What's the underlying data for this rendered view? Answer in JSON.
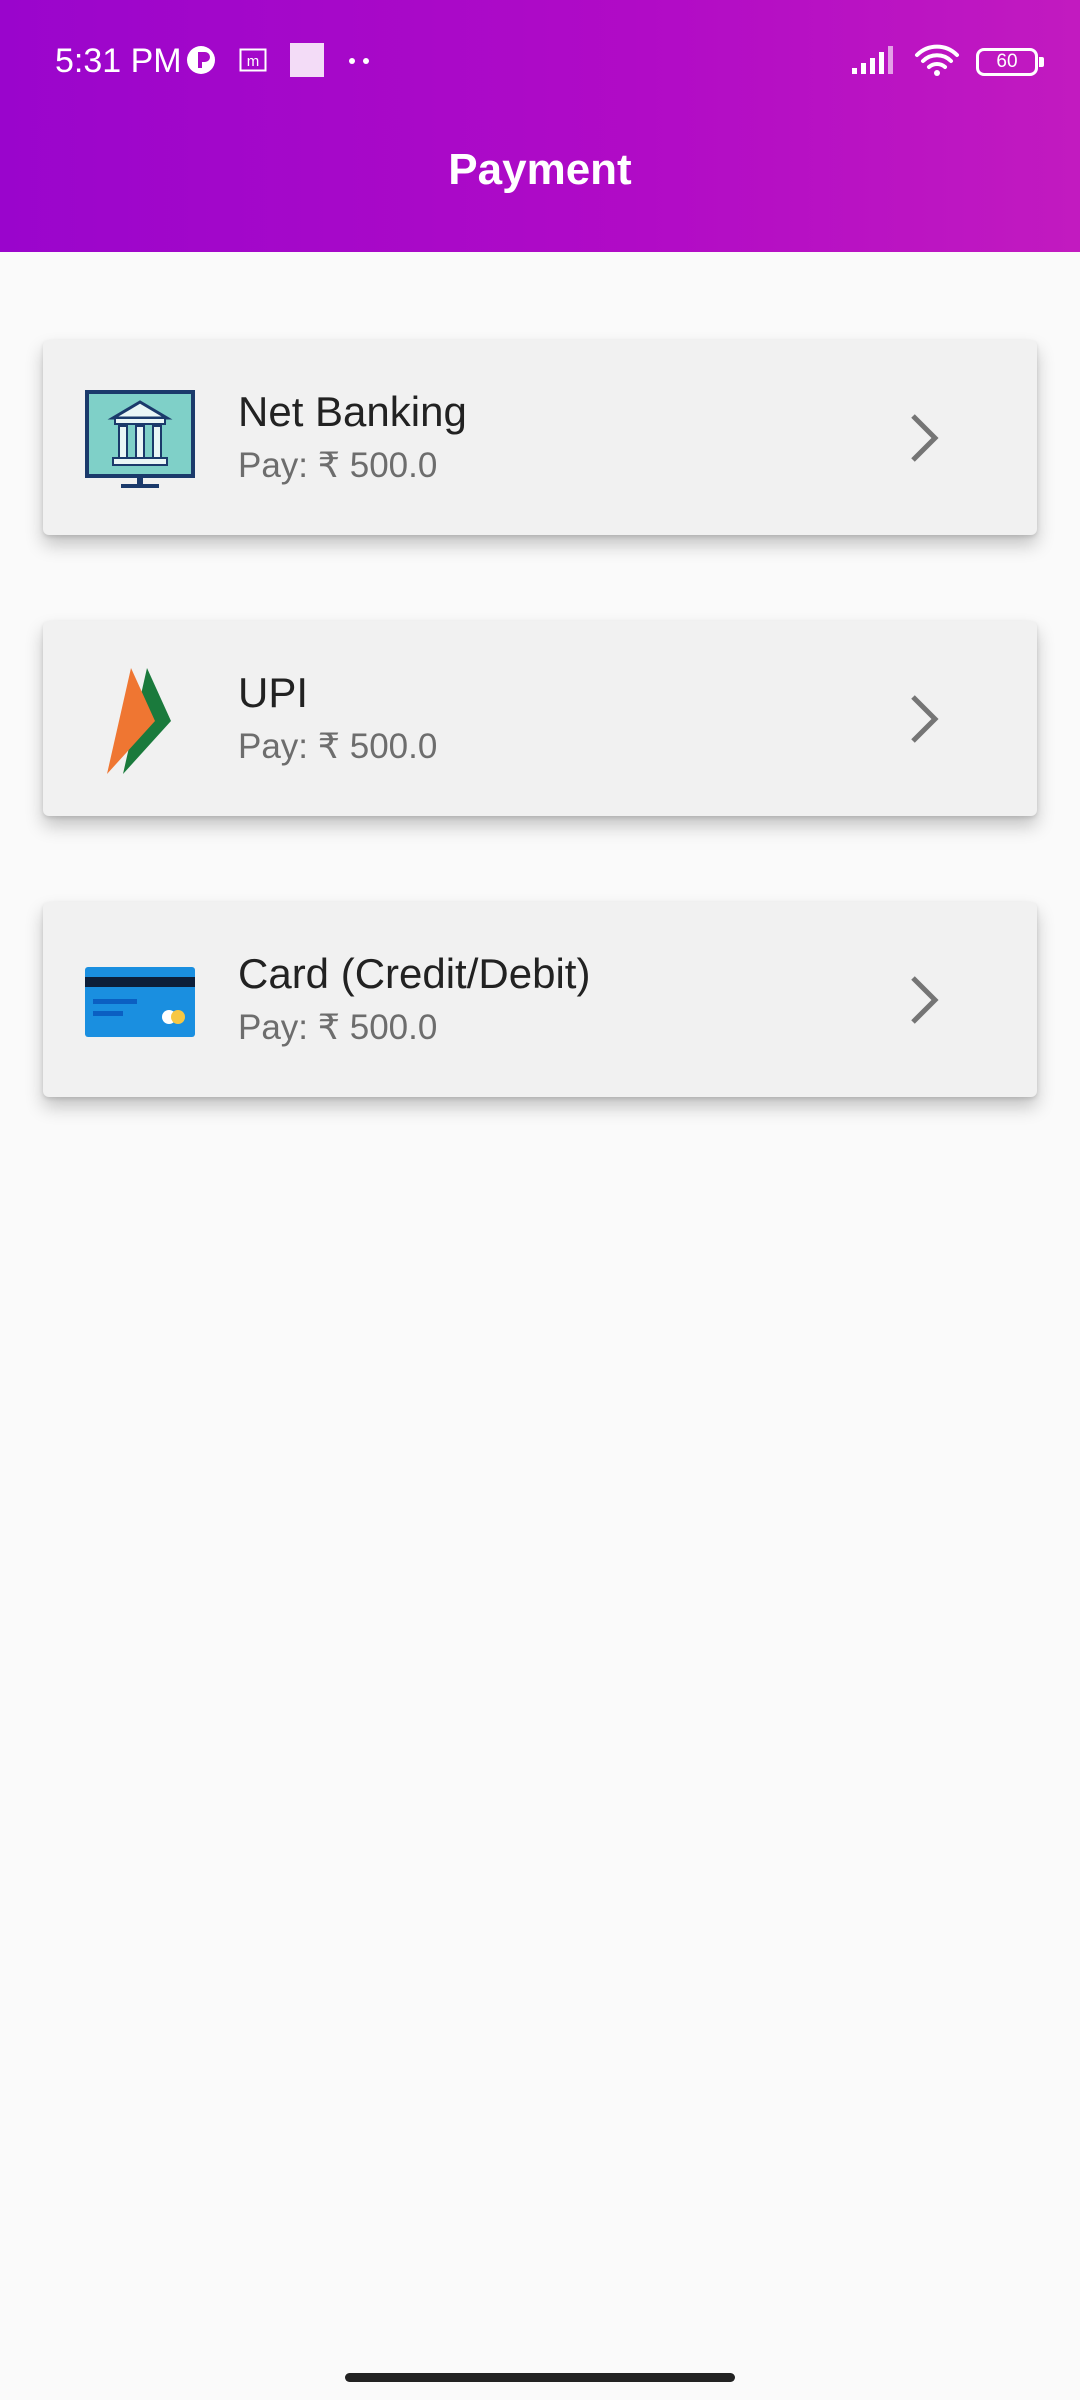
{
  "status_bar": {
    "time": "5:31 PM",
    "battery_level": "60",
    "icons": [
      "notification-p-icon",
      "app-m-icon",
      "square-notification-icon",
      "more-dots-icon",
      "signal-icon",
      "wifi-icon",
      "battery-icon"
    ]
  },
  "header": {
    "title": "Payment",
    "gradient_colors": [
      "#9a05cc",
      "#c21ac0"
    ]
  },
  "payment_methods": [
    {
      "name": "Net Banking",
      "pay_text": "Pay: ₹ 500.0",
      "icon": "bank-icon"
    },
    {
      "name": "UPI",
      "pay_text": "Pay: ₹ 500.0",
      "icon": "upi-icon"
    },
    {
      "name": "Card (Credit/Debit)",
      "pay_text": "Pay: ₹ 500.0",
      "icon": "credit-card-icon"
    }
  ]
}
